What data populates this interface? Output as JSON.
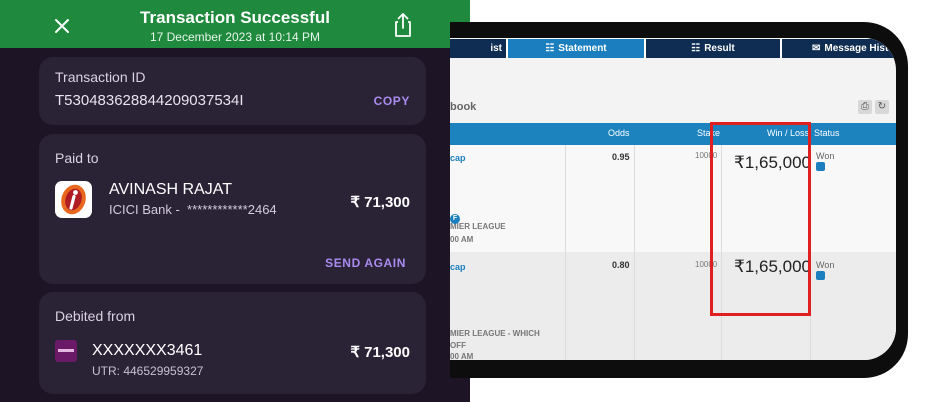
{
  "payment": {
    "header": {
      "title": "Transaction Successful",
      "datetime": "17 December 2023 at 10:14 PM",
      "bg_color": "#1f8a3d"
    },
    "transaction": {
      "label": "Transaction ID",
      "id": "T530483628844209037534I",
      "copy_label": "COPY"
    },
    "paid_to": {
      "label": "Paid to",
      "name": "AVINASH RAJAT",
      "bank": "ICICI Bank -  ************2464",
      "amount": "₹ 71,300",
      "send_again_label": "SEND AGAIN",
      "logo_icon": "icici-bank-icon"
    },
    "debited_from": {
      "label": "Debited from",
      "account": "XXXXXXX3461",
      "utr": "UTR: 446529959327",
      "amount": "₹ 71,300",
      "logo_icon": "bank-account-icon"
    }
  },
  "betting": {
    "tabs": [
      {
        "label": "ist",
        "icon": ""
      },
      {
        "label": "Statement",
        "icon": "statement-icon",
        "active": true
      },
      {
        "label": "Result",
        "icon": "result-icon"
      },
      {
        "label": "Message Histo",
        "icon": "mail-icon"
      }
    ],
    "book_title": "book",
    "table_headers": {
      "odds": "Odds",
      "stake": "Stake",
      "win_loss": "Win / Loss",
      "status": "Status"
    },
    "rows": [
      {
        "market": "cap",
        "badge": "F",
        "league": "MIER LEAGUE",
        "time": "00 AM",
        "odds": "0.95",
        "stake": "10000",
        "win_loss": "₹1,65,000",
        "status": "Won"
      },
      {
        "market": "cap",
        "league": "MIER LEAGUE - WHICH",
        "league2": "OFF",
        "time": "00 AM",
        "odds": "0.80",
        "stake": "10000",
        "win_loss": "₹1,65,000",
        "status": "Won"
      }
    ],
    "highlight_color": "#e02020"
  }
}
